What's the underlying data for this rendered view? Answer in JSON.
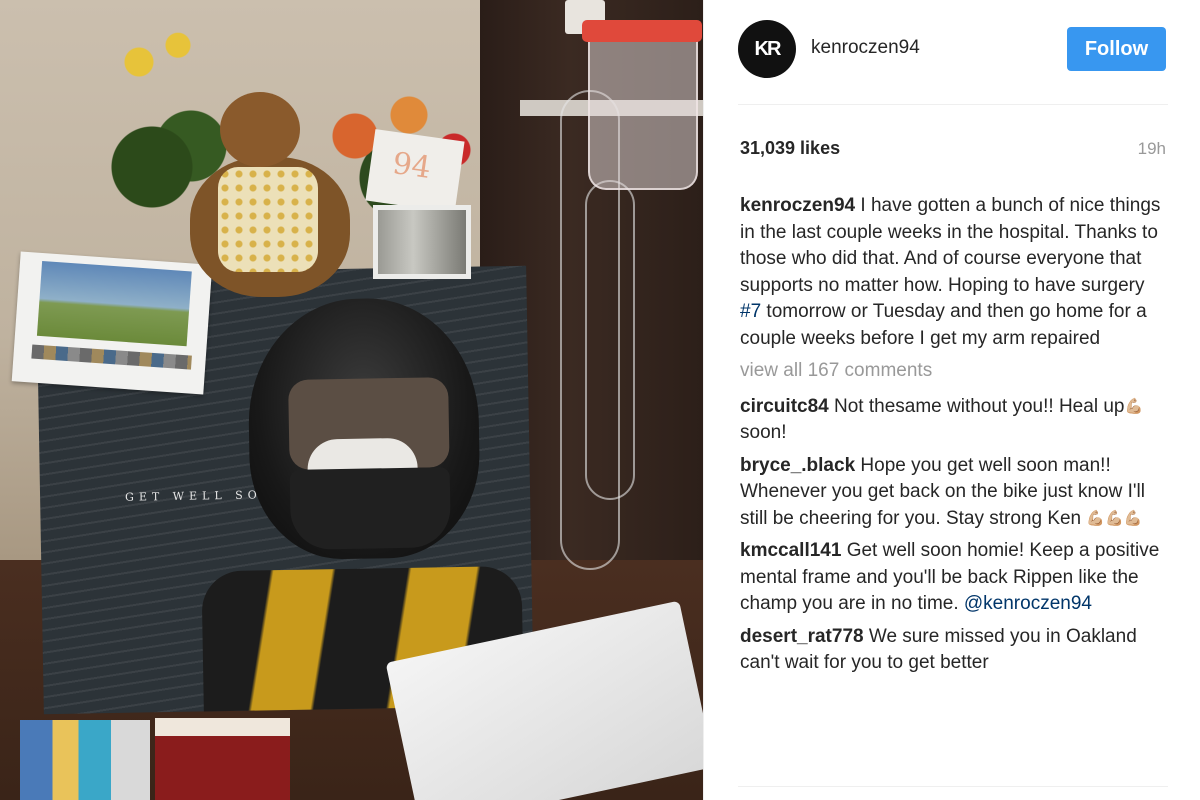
{
  "post": {
    "username": "kenroczen94",
    "avatar_text": "KR",
    "follow_label": "Follow",
    "likes": "31,039 likes",
    "time": "19h",
    "photo_print_text": "94",
    "poster_text": "GET WELL SOON",
    "caption": {
      "user": "kenroczen94",
      "text_before": " I have gotten a bunch of nice things in the last couple weeks in the hospital. Thanks to those who did that. And of course everyone that supports no matter how. Hoping to have surgery ",
      "hashtag": "#7",
      "text_after": " tomorrow or Tuesday and then go home for a couple weeks before I get my arm repaired"
    },
    "view_all": "view all 167 comments",
    "comments": [
      {
        "user": "circuitc84",
        "text": " Not thesame without you!! Heal up",
        "emoji": "💪🏼",
        "text2": " soon!"
      },
      {
        "user": "bryce_.black",
        "text": " Hope you get well soon man!! Whenever you get back on the bike just know I'll still be cheering for you. Stay strong Ken ",
        "emoji": "💪🏼💪🏼💪🏼"
      },
      {
        "user": "kmccall141",
        "text": " Get well soon homie! Keep a positive mental frame and you'll be back Rippen like the champ you are in no time. ",
        "mention": "@kenroczen94"
      },
      {
        "user": "desert_rat778",
        "text": " We sure missed you in Oakland can't wait for you to get better"
      }
    ]
  },
  "colors": {
    "follow_button": "#3897f0",
    "link": "#003569",
    "muted": "#999999",
    "text": "#262626"
  },
  "icons": {
    "avatar": "kr-logo"
  }
}
